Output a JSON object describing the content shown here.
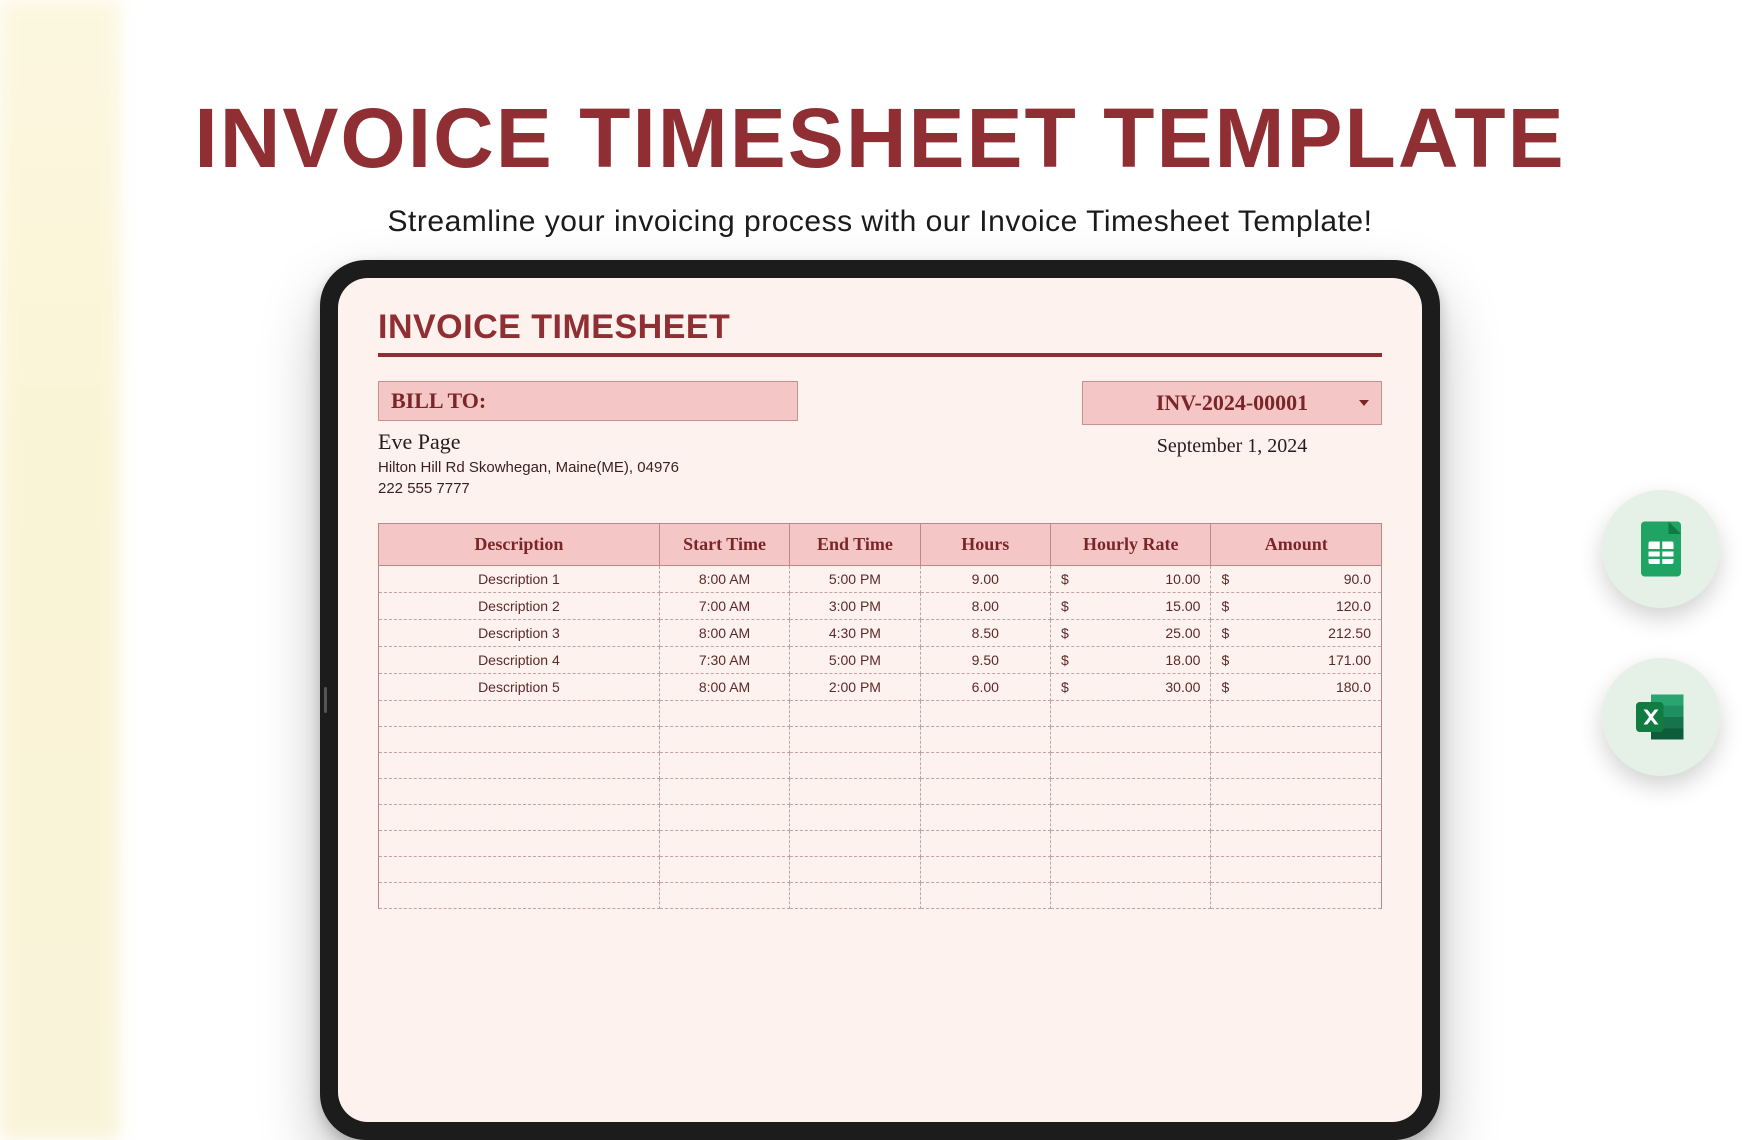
{
  "hero": {
    "title": "INVOICE TIMESHEET TEMPLATE",
    "subtitle": "Streamline your invoicing process with our Invoice Timesheet Template!"
  },
  "sheet": {
    "title": "INVOICE TIMESHEET",
    "bill_to_label": "BILL TO:",
    "bill_name": "Eve Page",
    "bill_address": "Hilton Hill Rd Skowhegan, Maine(ME), 04976",
    "bill_phone": "222 555 7777",
    "invoice_number": "INV-2024-00001",
    "invoice_date": "September 1, 2024",
    "columns": {
      "description": "Description",
      "start_time": "Start Time",
      "end_time": "End Time",
      "hours": "Hours",
      "hourly_rate": "Hourly Rate",
      "amount": "Amount"
    },
    "currency": "$",
    "rows": [
      {
        "description": "Description 1",
        "start": "8:00 AM",
        "end": "5:00 PM",
        "hours": "9.00",
        "rate": "10.00",
        "amount": "90.0"
      },
      {
        "description": "Description 2",
        "start": "7:00 AM",
        "end": "3:00 PM",
        "hours": "8.00",
        "rate": "15.00",
        "amount": "120.0"
      },
      {
        "description": "Description 3",
        "start": "8:00 AM",
        "end": "4:30 PM",
        "hours": "8.50",
        "rate": "25.00",
        "amount": "212.50"
      },
      {
        "description": "Description 4",
        "start": "7:30 AM",
        "end": "5:00 PM",
        "hours": "9.50",
        "rate": "18.00",
        "amount": "171.00"
      },
      {
        "description": "Description 5",
        "start": "8:00 AM",
        "end": "2:00 PM",
        "hours": "6.00",
        "rate": "30.00",
        "amount": "180.0"
      }
    ],
    "empty_rows": 8
  },
  "badges": {
    "sheets": "google-sheets-icon",
    "excel": "excel-icon"
  }
}
